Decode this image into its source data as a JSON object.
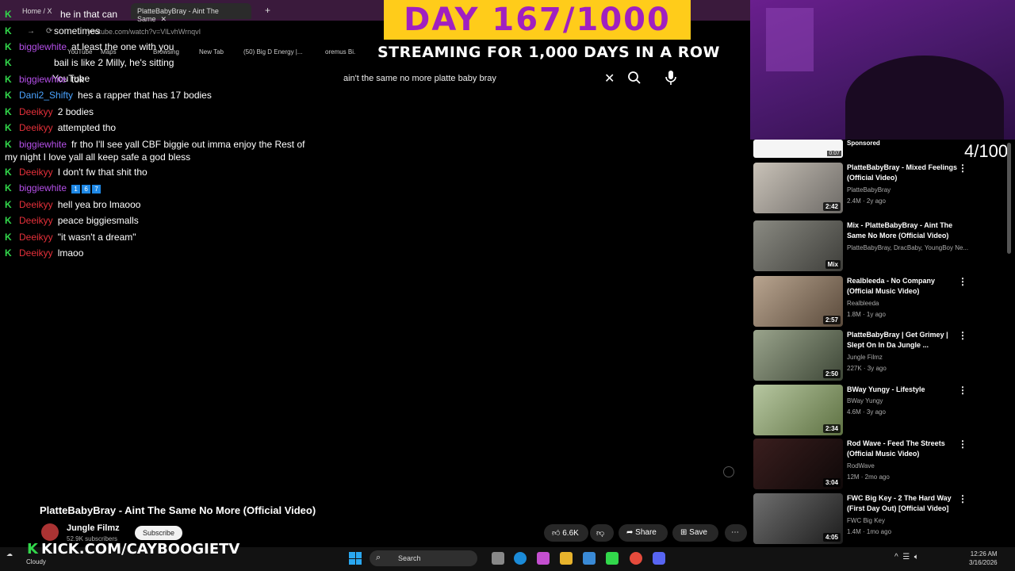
{
  "browser": {
    "tabs": [
      {
        "label": "Home / X",
        "active": false
      },
      {
        "label": "PlatteBabyBray - Aint The Same",
        "active": true
      }
    ],
    "new_tab_symbol": "+",
    "url": "youtube.com/watch?v=VlLvhWrnqvI",
    "bookmarks": [
      "YouTube",
      "Maps",
      "Browsing",
      "New Tab",
      "(50) Big D Energy |...",
      "oremus Bi..."
    ]
  },
  "overlay": {
    "day_banner": "DAY 167/1000",
    "streaming_banner": "STREAMING FOR 1,000 DAYS IN A ROW",
    "counter": "4/100",
    "kick_url": "KICK.COM/CAYBOOGIETV",
    "kick_letter": "K"
  },
  "youtube": {
    "logo": "YouTube",
    "search_value": "ain't the same no more platte baby bray",
    "video_title": "PlatteBabyBray - Aint The Same No More (Official Video)",
    "channel_name": "Jungle Filmz",
    "subscribers": "52.9K subscribers",
    "subscribe_label": "Subscribe",
    "like_count": "6.6K",
    "share_label": "Share",
    "save_label": "Save",
    "sponsored_label": "Sponsored",
    "ad_duration": "0:07"
  },
  "chat": [
    {
      "user": "",
      "color": "#ffffff",
      "msg": "he in that can"
    },
    {
      "user": "",
      "color": "#ffffff",
      "msg": "sometimes"
    },
    {
      "user": "bigglewhite",
      "color": "#b44fe8",
      "msg": "at least the one with you"
    },
    {
      "user": "",
      "color": "#ffffff",
      "msg": "bail is like 2 Milly, he's sitting"
    },
    {
      "user": "biggiewhite",
      "color": "#b44fe8",
      "msg": "tok"
    },
    {
      "user": "Dani2_Shifty",
      "color": "#4aa3ff",
      "msg": "hes a rapper that has 17 bodies"
    },
    {
      "user": "Deeikyy",
      "color": "#e5303a",
      "msg": "2 bodies"
    },
    {
      "user": "Deeikyy",
      "color": "#e5303a",
      "msg": "attempted tho"
    },
    {
      "user": "biggiewhite",
      "color": "#b44fe8",
      "msg": "fr tho I'll see yall CBF biggie out imma enjoy the Rest of"
    },
    {
      "user": "",
      "color": "#ffffff",
      "msg": "my night I love yall all keep safe a god bless"
    },
    {
      "user": "Deeikyy",
      "color": "#e5303a",
      "msg": "I don't fw that shit tho"
    },
    {
      "user": "biggiewhite",
      "color": "#b44fe8",
      "msg": ""
    },
    {
      "user": "Deeikyy",
      "color": "#e5303a",
      "msg": "hell yea bro lmaooo"
    },
    {
      "user": "Deeikyy",
      "color": "#e5303a",
      "msg": "peace biggiesmalls"
    },
    {
      "user": "Deeikyy",
      "color": "#e5303a",
      "msg": "\"it wasn't a dream\""
    },
    {
      "user": "Deeikyy",
      "color": "#e5303a",
      "msg": "lmaoo"
    }
  ],
  "chat_emotes": [
    "1",
    "6",
    "7"
  ],
  "recommendations": [
    {
      "title": "PlatteBabyBray - Mixed Feelings (Official Video)",
      "channel": "PlatteBabyBray",
      "meta": "2.4M · 2y ago",
      "duration": "2:42"
    },
    {
      "title": "Mix - PlatteBabyBray - Aint The Same No More (Official Video)",
      "channel": "PlatteBabyBray, DracBaby, YoungBoy Ne...",
      "meta": "",
      "duration": "Mix"
    },
    {
      "title": "Realbleeda - No Company (Official Music Video)",
      "channel": "Realbleeda",
      "meta": "1.8M · 1y ago",
      "duration": "2:57"
    },
    {
      "title": "PlatteBabyBray | Get Grimey | Slept On In Da Jungle ...",
      "channel": "Jungle Filmz",
      "meta": "227K · 3y ago",
      "duration": "2:50"
    },
    {
      "title": "BWay Yungy - Lifestyle",
      "channel": "BWay Yungy",
      "meta": "4.6M · 3y ago",
      "duration": "2:34"
    },
    {
      "title": "Rod Wave - Feed The Streets (Official Music Video)",
      "channel": "RodWave",
      "meta": "12M · 2mo ago",
      "duration": "3:04"
    },
    {
      "title": "FWC Big Key - 2 The Hard Way (First Day Out) [Official Video]",
      "channel": "FWC Big Key",
      "meta": "1.4M · 1mo ago",
      "duration": "4:05"
    }
  ],
  "taskbar": {
    "weather_label": "Cloudy",
    "search_label": "Search",
    "time": "12:26 AM",
    "date": "3/16/2026"
  },
  "colors": {
    "kick_green": "#32d74b",
    "banner_yellow": "#ffcc1a",
    "banner_text": "#a020c0"
  }
}
